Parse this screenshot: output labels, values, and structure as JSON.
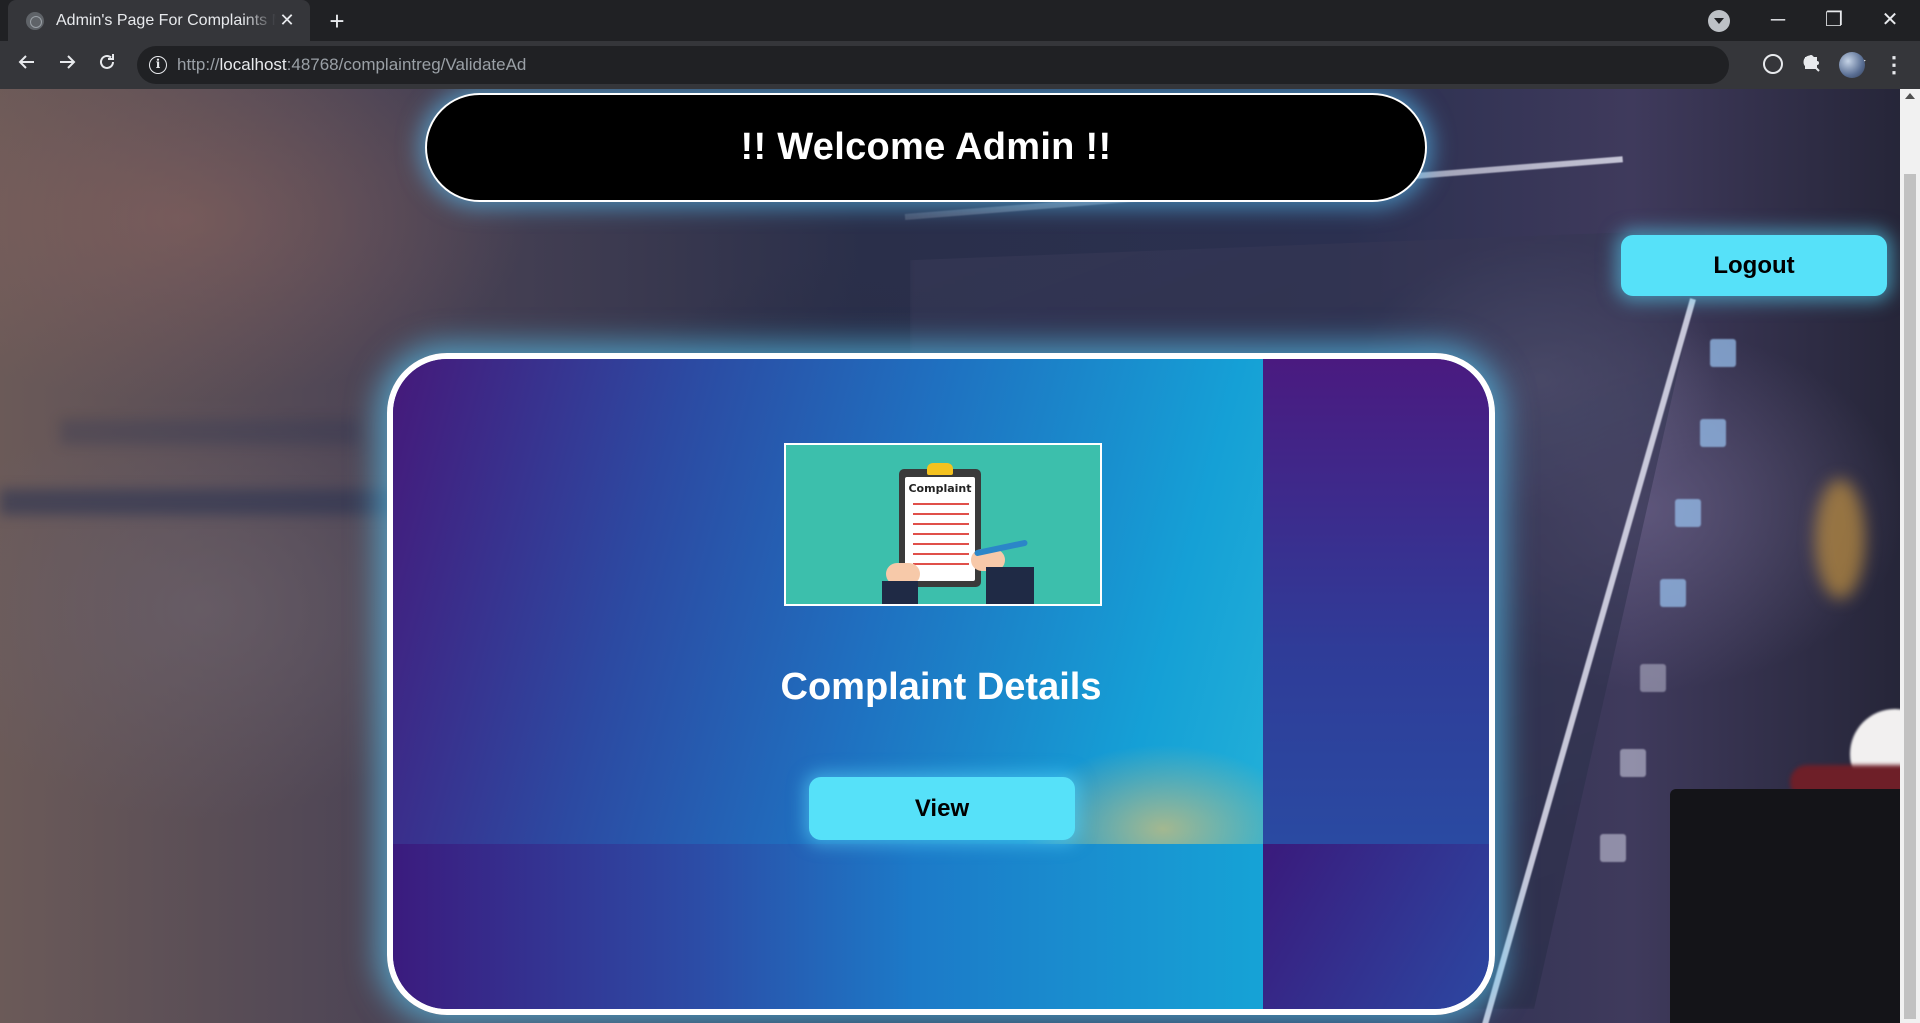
{
  "browser": {
    "tab_title": "Admin's Page For Complaints Management",
    "tab_close": "✕",
    "new_tab": "+",
    "url_prefix": "http://",
    "url_host": "localhost",
    "url_rest": ":48768/complaintreg/ValidateAd",
    "window_minimize": "─",
    "window_maximize": "❐",
    "window_close": "✕"
  },
  "page": {
    "welcome_text": "!! Welcome Admin !!",
    "logout_label": "Logout",
    "card": {
      "image_caption": "Complaint",
      "title": "Complaint Details",
      "view_label": "View"
    }
  },
  "colors": {
    "button_accent": "#56e1f9",
    "welcome_bg": "#000000",
    "glow": "#5ad2ff"
  },
  "icons": [
    "back-icon",
    "forward-icon",
    "reload-icon",
    "info-icon",
    "zoom-icon",
    "star-icon",
    "extension-icon",
    "puzzle-icon",
    "profile-avatar",
    "menu-icon"
  ]
}
